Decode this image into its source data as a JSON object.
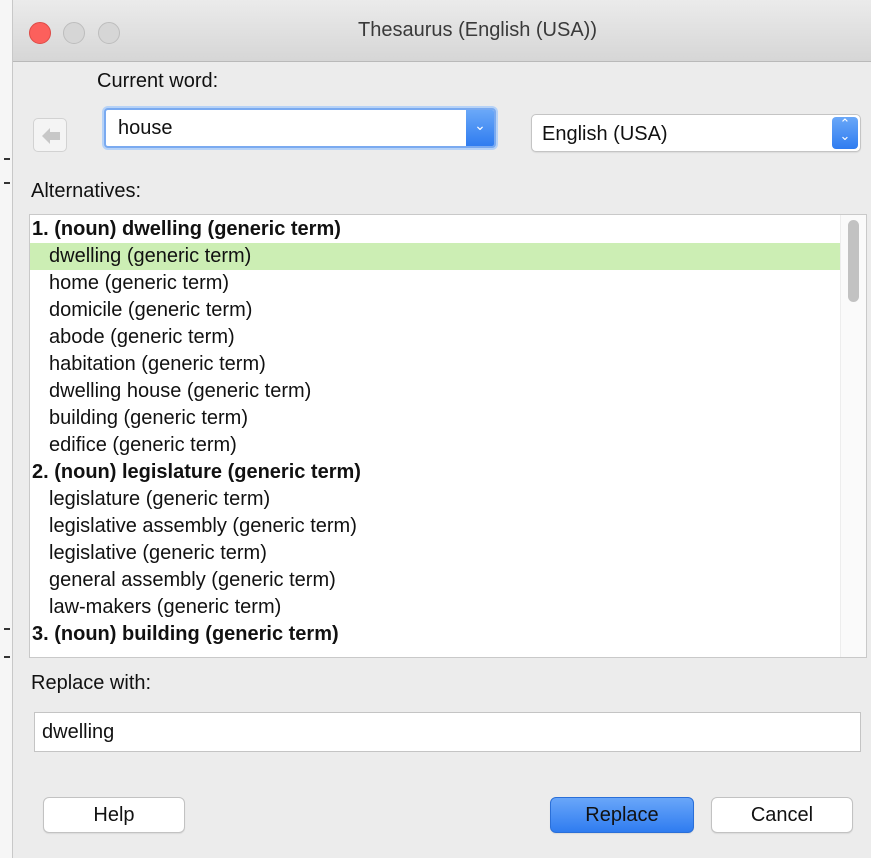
{
  "window": {
    "title": "Thesaurus (English (USA))"
  },
  "current_word": {
    "label": "Current word:",
    "value": "house"
  },
  "language": {
    "selected": "English (USA)"
  },
  "alternatives": {
    "label": "Alternatives:",
    "rows": [
      {
        "text": "1. (noun) dwelling (generic term)",
        "kind": "heading"
      },
      {
        "text": "dwelling (generic term)",
        "kind": "item",
        "selected": true
      },
      {
        "text": "home (generic term)",
        "kind": "item"
      },
      {
        "text": "domicile (generic term)",
        "kind": "item"
      },
      {
        "text": "abode (generic term)",
        "kind": "item"
      },
      {
        "text": "habitation (generic term)",
        "kind": "item"
      },
      {
        "text": "dwelling house (generic term)",
        "kind": "item"
      },
      {
        "text": "building (generic term)",
        "kind": "item"
      },
      {
        "text": "edifice (generic term)",
        "kind": "item"
      },
      {
        "text": "2. (noun) legislature (generic term)",
        "kind": "heading"
      },
      {
        "text": "legislature (generic term)",
        "kind": "item"
      },
      {
        "text": "legislative assembly (generic term)",
        "kind": "item"
      },
      {
        "text": "legislative (generic term)",
        "kind": "item"
      },
      {
        "text": "general assembly (generic term)",
        "kind": "item"
      },
      {
        "text": "law-makers (generic term)",
        "kind": "item"
      },
      {
        "text": "3. (noun) building (generic term)",
        "kind": "heading"
      }
    ]
  },
  "replace_with": {
    "label": "Replace with:",
    "value": "dwelling"
  },
  "buttons": {
    "help": "Help",
    "replace": "Replace",
    "cancel": "Cancel"
  },
  "colors": {
    "selection": "#cceeb4",
    "accent": "#2f7cf0",
    "close": "#fc605c"
  },
  "icons": {
    "back": "arrow-left-icon",
    "combo_dropdown": "chevron-down-icon",
    "select_dropdown": "updown-chevron-icon"
  }
}
